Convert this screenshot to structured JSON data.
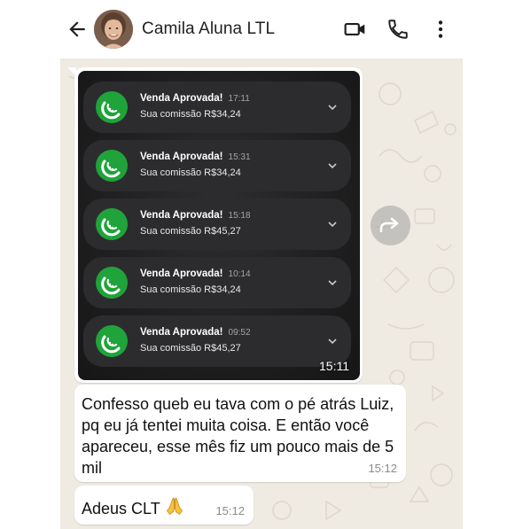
{
  "header": {
    "contact_name": "Camila Aluna LTL",
    "icons": [
      "back-arrow-icon",
      "video-call-icon",
      "voice-call-icon",
      "more-options-icon"
    ]
  },
  "image_message": {
    "notifications": [
      {
        "title": "Venda Aprovada!",
        "time": "17:11",
        "body": "Sua comissão R$34,24"
      },
      {
        "title": "Venda Aprovada!",
        "time": "15:31",
        "body": "Sua comissão R$34,24"
      },
      {
        "title": "Venda Aprovada!",
        "time": "15:18",
        "body": "Sua comissão R$45,27"
      },
      {
        "title": "Venda Aprovada!",
        "time": "10:14",
        "body": "Sua comissão R$34,24"
      },
      {
        "title": "Venda Aprovada!",
        "time": "09:52",
        "body": "Sua comissão R$45,27"
      }
    ],
    "time": "15:11"
  },
  "messages": [
    {
      "text": "Confesso queb eu tava com o pé atrás Luiz, pq eu  já tentei muita coisa. E então você apareceu, esse mês fiz um pouco mais de 5 mil",
      "time": "15:12"
    },
    {
      "text": "Adeus CLT",
      "emoji": "folded-hands-icon",
      "time": "15:12"
    }
  ],
  "colors": {
    "chat_background": "#efeae2",
    "bubble": "#ffffff",
    "notification_app": "#1fa33a",
    "notification_card": "#2c2c2e"
  }
}
